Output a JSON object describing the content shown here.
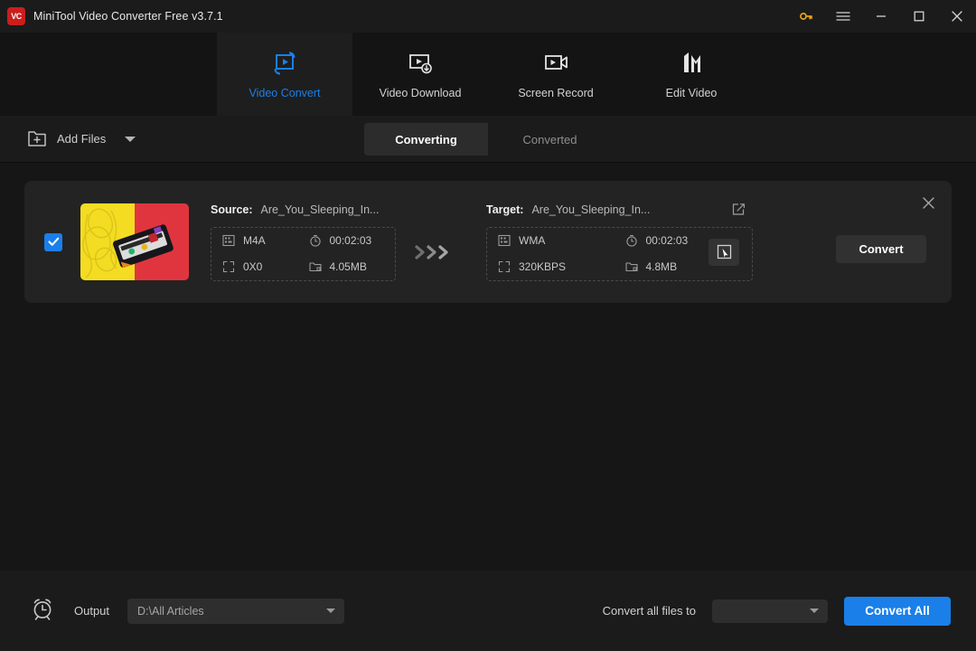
{
  "window": {
    "title": "MiniTool Video Converter Free v3.7.1",
    "logo_text": "VC",
    "controls": {
      "key": "key-icon",
      "menu": "hamburger-menu-icon",
      "minimize": "minimize-icon",
      "maximize": "maximize-icon",
      "close": "close-icon"
    }
  },
  "nav": {
    "tabs": [
      {
        "label": "Video Convert",
        "icon": "video-convert-icon",
        "active": true
      },
      {
        "label": "Video Download",
        "icon": "video-download-icon",
        "active": false
      },
      {
        "label": "Screen Record",
        "icon": "screen-record-icon",
        "active": false
      },
      {
        "label": "Edit Video",
        "icon": "edit-video-icon",
        "active": false
      }
    ]
  },
  "toolbar": {
    "add_files_label": "Add Files",
    "add_files_icon": "folder-plus-icon",
    "segments": [
      {
        "label": "Converting",
        "active": true
      },
      {
        "label": "Converted",
        "active": false
      }
    ]
  },
  "file_card": {
    "selected": true,
    "thumbnail": "cassette-tape-photo",
    "source": {
      "label": "Source:",
      "filename": "Are_You_Sleeping_In...",
      "format": "M4A",
      "duration": "00:02:03",
      "resolution": "0X0",
      "filesize": "4.05MB"
    },
    "target": {
      "label": "Target:",
      "filename": "Are_You_Sleeping_In...",
      "format": "WMA",
      "duration": "00:02:03",
      "bitrate": "320KBPS",
      "filesize": "4.8MB"
    },
    "convert_label": "Convert",
    "close_icon": "close-icon",
    "edit_icon": "edit-square-icon",
    "select_format_icon": "cursor-select-icon"
  },
  "bottom": {
    "schedule_icon": "alarm-clock-icon",
    "output_label": "Output",
    "output_path": "D:\\All Articles",
    "convert_all_files_to_label": "Convert all files to",
    "format_select_value": "",
    "convert_all_label": "Convert All"
  },
  "colors": {
    "accent_blue": "#1a7fe8",
    "logo_red": "#cc1d1d",
    "key_orange": "#e8a317",
    "card_bg": "#232323",
    "window_bg": "#161616"
  }
}
